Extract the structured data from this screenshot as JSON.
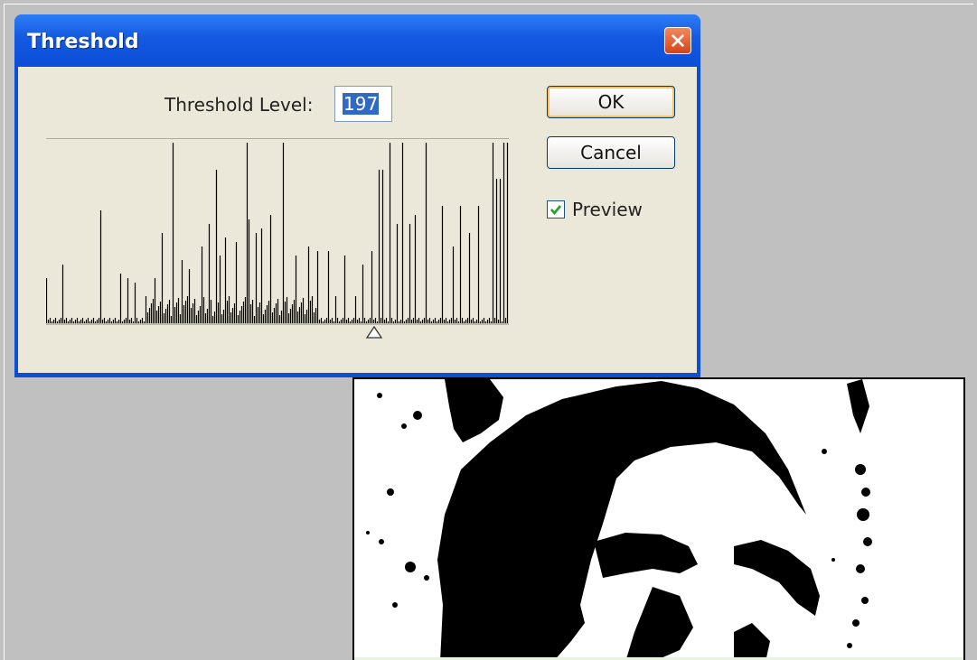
{
  "dialog": {
    "title": "Threshold",
    "threshold_label": "Threshold Level:",
    "threshold_value": "197",
    "ok_label": "OK",
    "cancel_label": "Cancel",
    "preview_label": "Preview",
    "preview_checked": true
  },
  "icons": {
    "close": "close-icon",
    "checkmark": "checkmark-icon",
    "slider": "slider-thumb-icon"
  },
  "colors": {
    "titlebar": "#0b4fd8",
    "dialog_face": "#ebe8d9",
    "close_button": "#d6431a",
    "selection": "#316ac5",
    "workspace": "#c0c0c0"
  }
}
